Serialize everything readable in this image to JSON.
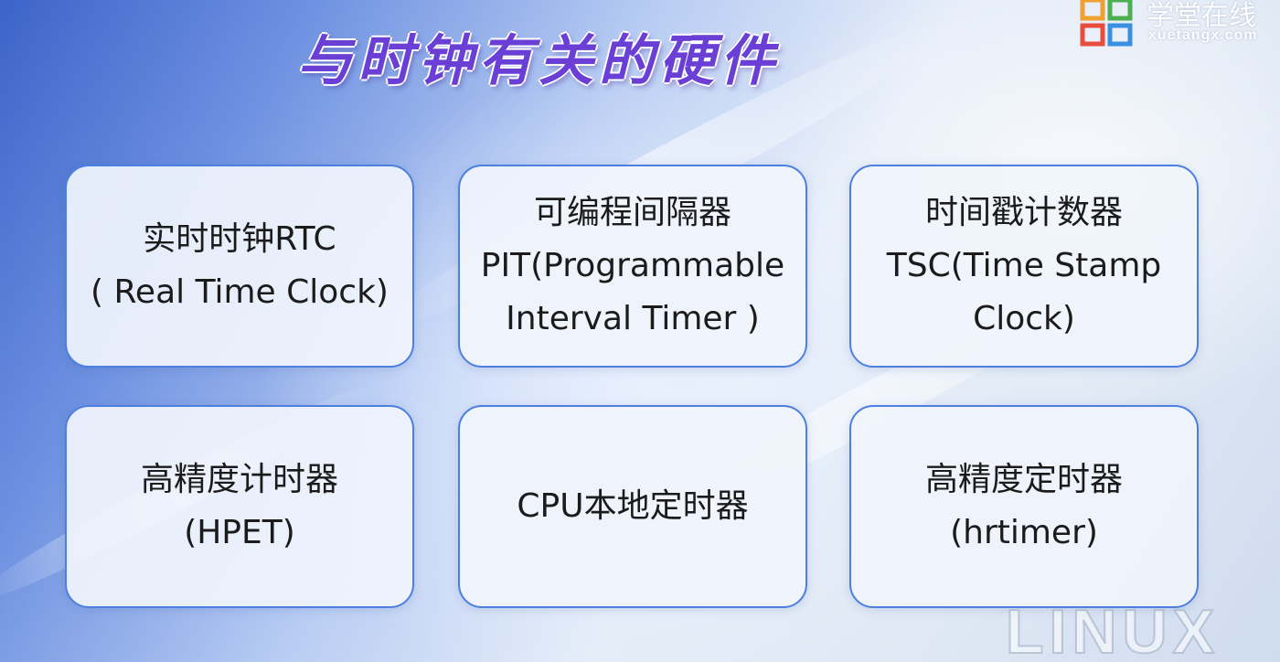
{
  "slide": {
    "title": "与时钟有关的硬件",
    "logo": {
      "cn": "学堂在线",
      "en": "xuetangx.com"
    },
    "watermark": "LINUX",
    "cards": [
      {
        "lines": [
          "实时时钟RTC",
          "( Real Time Clock)"
        ]
      },
      {
        "lines": [
          "可编程间隔器",
          "PIT(Programmable",
          "Interval Timer )"
        ]
      },
      {
        "lines": [
          "时间戳计数器",
          "TSC(Time Stamp",
          "Clock)"
        ]
      },
      {
        "lines": [
          "高精度计时器",
          "(HPET)"
        ]
      },
      {
        "lines": [
          "CPU本地定时器"
        ]
      },
      {
        "lines": [
          "高精度定时器",
          "(hrtimer)"
        ]
      }
    ]
  },
  "colors": {
    "title": "#6a3fd6",
    "card_border": "#4d7fe0",
    "card_bg": "#f0f4fc",
    "text": "#1b1b1b"
  }
}
